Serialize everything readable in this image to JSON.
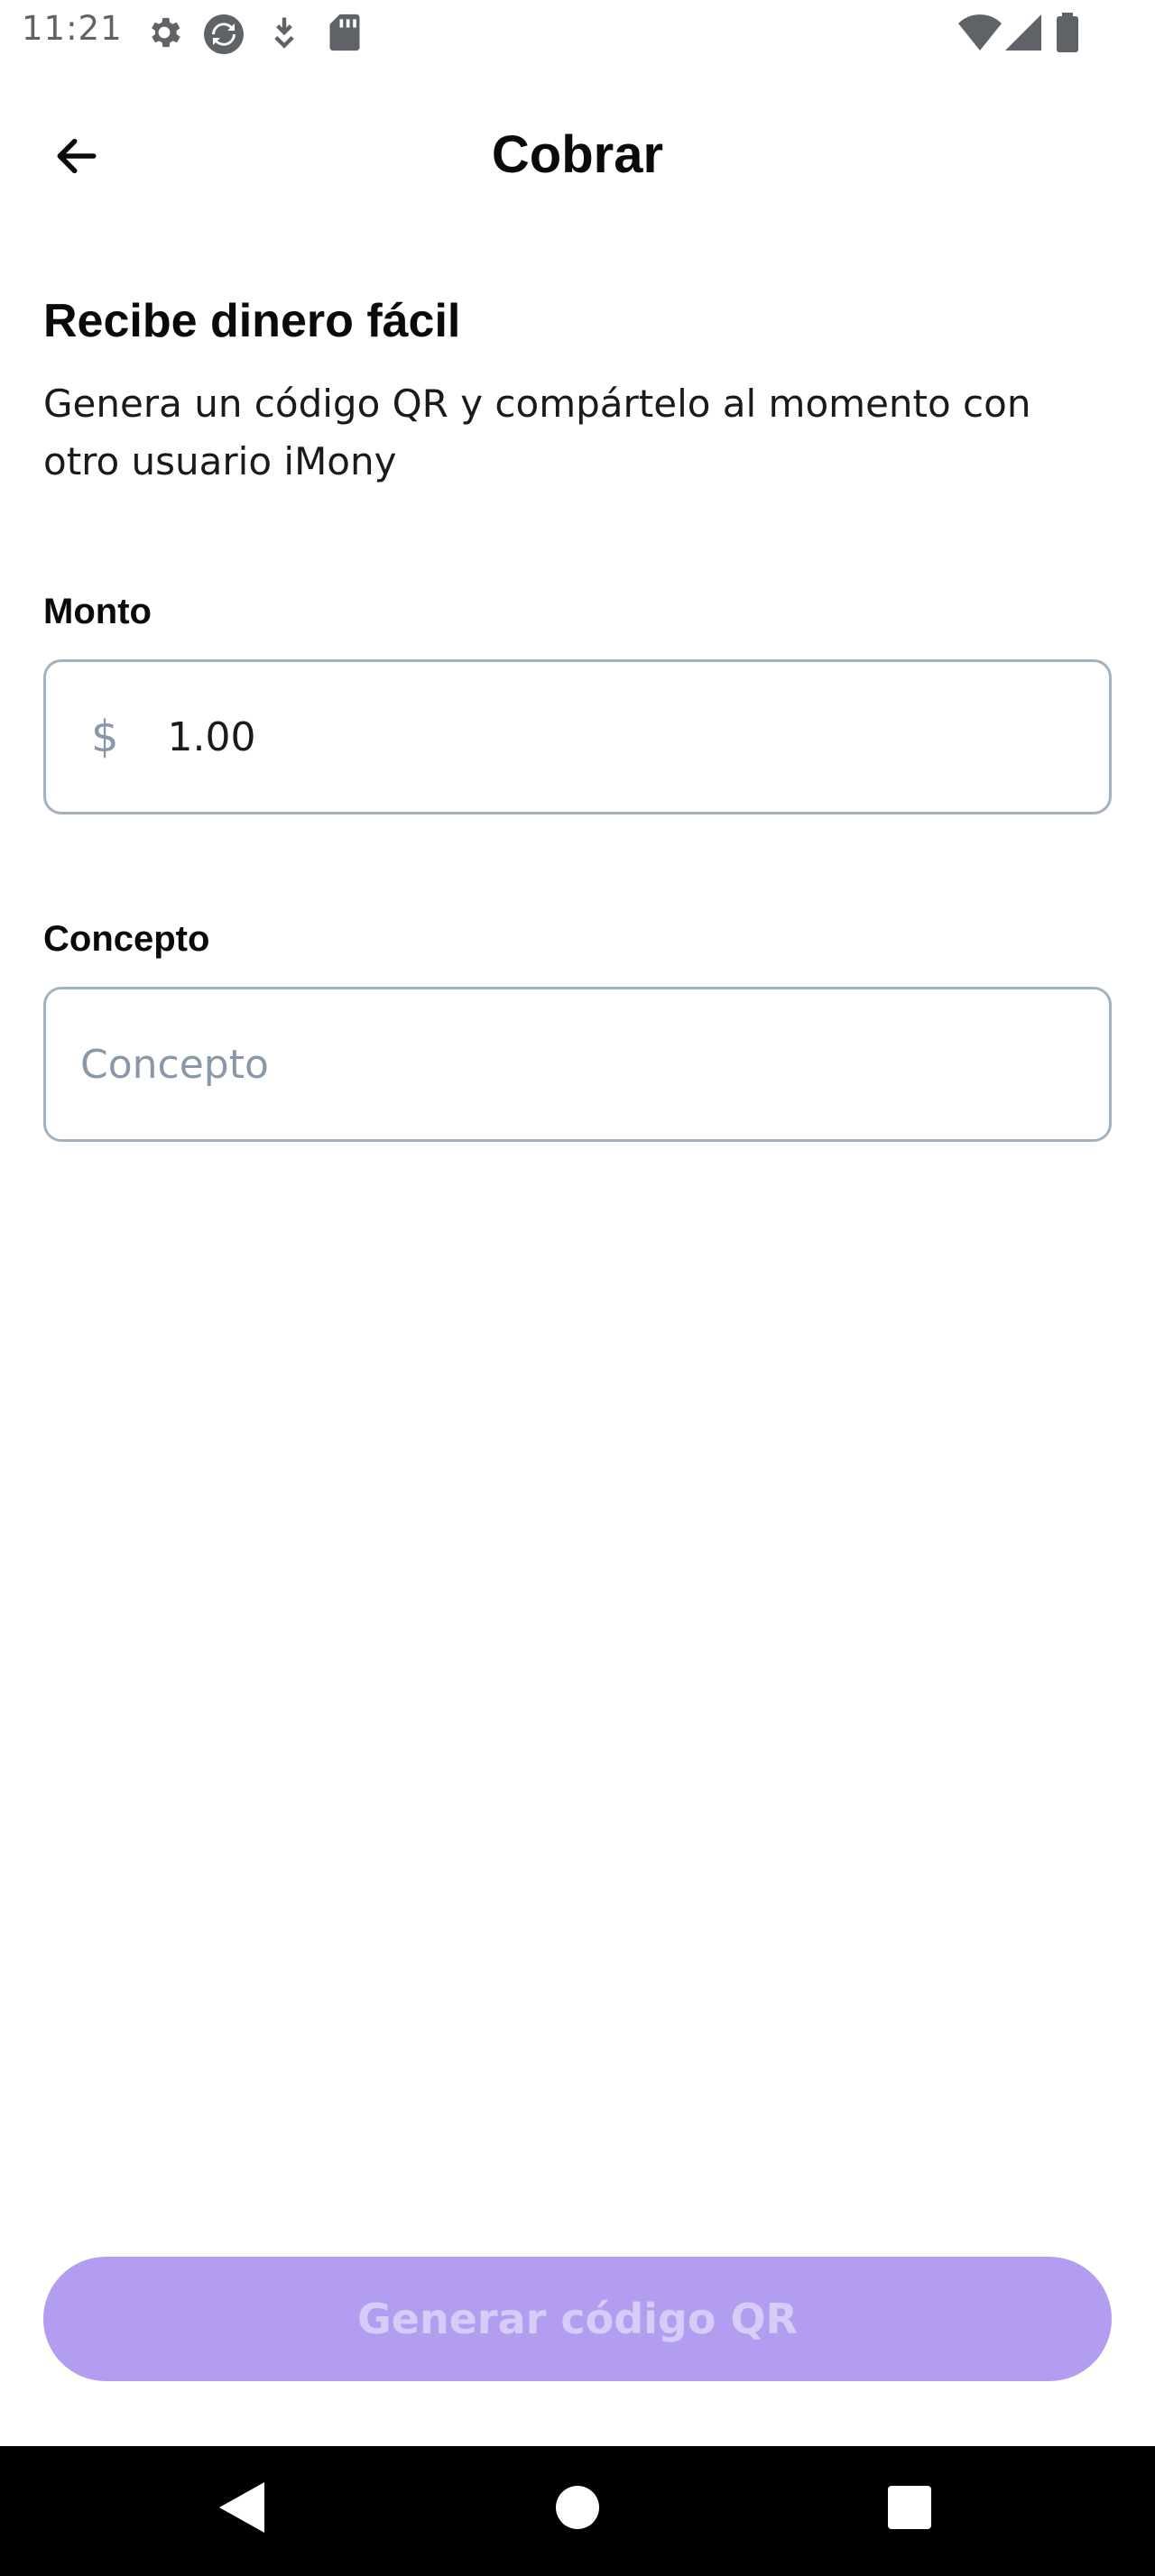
{
  "status_bar": {
    "time": "11:21",
    "icons_left": [
      "gear-icon",
      "sync-app-icon",
      "download-icon",
      "sd-card-icon"
    ],
    "icons_right": [
      "wifi-icon",
      "signal-icon",
      "battery-icon"
    ]
  },
  "app_bar": {
    "back_icon": "arrow-left-icon",
    "title": "Cobrar"
  },
  "content": {
    "heading": "Recibe dinero fácil",
    "subtitle": "Genera un código QR y compártelo al momento con otro usuario iMony"
  },
  "amount_field": {
    "label": "Monto",
    "currency_symbol": "$",
    "value": "1.00"
  },
  "concept_field": {
    "label": "Concepto",
    "value": "",
    "placeholder": "Concepto"
  },
  "primary_button": {
    "label": "Generar código QR",
    "state": "disabled"
  },
  "nav_bar": {
    "items": [
      "back-triangle-icon",
      "home-circle-icon",
      "recents-square-icon"
    ]
  },
  "colors": {
    "button_bg": "#b39df0",
    "button_text": "#d7cbf8",
    "field_border": "#a4b1c1",
    "placeholder": "#8a97aa"
  }
}
